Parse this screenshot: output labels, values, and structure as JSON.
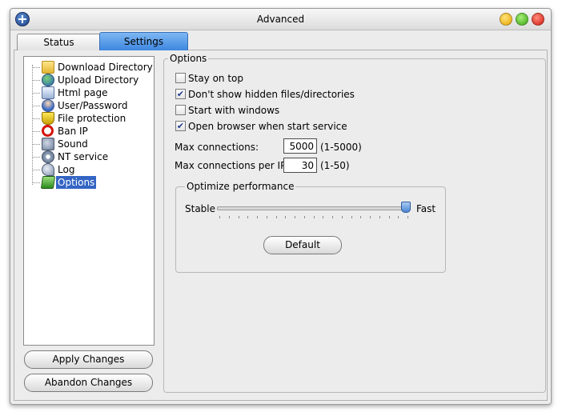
{
  "window": {
    "title": "Advanced"
  },
  "tabs": [
    {
      "label": "Status"
    },
    {
      "label": "Settings"
    }
  ],
  "tree": {
    "items": [
      {
        "label": "Download Directory",
        "icon": "folder-icon"
      },
      {
        "label": "Upload Directory",
        "icon": "globe-icon"
      },
      {
        "label": "Html page",
        "icon": "page-icon"
      },
      {
        "label": "User/Password",
        "icon": "user-icon"
      },
      {
        "label": "File protection",
        "icon": "shield-icon"
      },
      {
        "label": "Ban IP",
        "icon": "ban-icon"
      },
      {
        "label": "Sound",
        "icon": "speaker-icon"
      },
      {
        "label": "NT service",
        "icon": "gear-icon"
      },
      {
        "label": "Log",
        "icon": "log-icon"
      },
      {
        "label": "Options",
        "icon": "check-icon",
        "selected": true
      }
    ]
  },
  "left_buttons": {
    "apply_label": "Apply Changes",
    "abandon_label": "Abandon Changes"
  },
  "options": {
    "group_label": "Options",
    "checkboxes": [
      {
        "label": "Stay on top",
        "checked": false
      },
      {
        "label": "Don't show hidden files/directories",
        "checked": true
      },
      {
        "label": "Start with windows",
        "checked": false
      },
      {
        "label": "Open browser when start service",
        "checked": true
      }
    ],
    "max_connections": {
      "label": "Max connections:",
      "value": "5000",
      "range": "(1-5000)"
    },
    "max_connections_per_ip": {
      "label": "Max connections per IP:",
      "value": "30",
      "range": "(1-50)"
    }
  },
  "performance": {
    "group_label": "Optimize performance",
    "left_label": "Stable",
    "right_label": "Fast",
    "slider_value_fraction": 1.0,
    "default_label": "Default"
  },
  "colors": {
    "selection": "#3465c4",
    "active_tab": "#5a9be8"
  }
}
